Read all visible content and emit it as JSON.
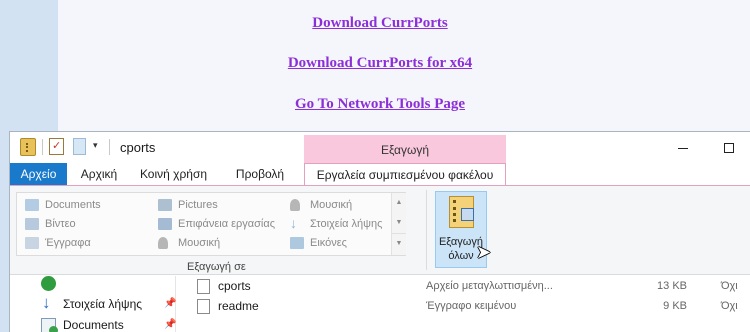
{
  "web": {
    "links": [
      "Download CurrPorts",
      "Download CurrPorts for x64",
      "Go To Network Tools Page"
    ]
  },
  "window": {
    "title": "cports",
    "contextual_tab_header": "Εξαγωγή",
    "controls": {
      "minimize": "minimize",
      "maximize": "maximize"
    }
  },
  "tabs": [
    "Αρχείο",
    "Αρχική",
    "Κοινή χρήση",
    "Προβολή",
    "Εργαλεία συμπιεσμένου φακέλου"
  ],
  "ribbon": {
    "extract_to_items": [
      {
        "label": "Documents",
        "icon": "documents-icon"
      },
      {
        "label": "Pictures",
        "icon": "pictures-icon"
      },
      {
        "label": "Μουσική",
        "icon": "music-icon"
      },
      {
        "label": "Βίντεο",
        "icon": "video-icon"
      },
      {
        "label": "Επιφάνεια εργασίας",
        "icon": "desktop-icon"
      },
      {
        "label": "Στοιχεία λήψης",
        "icon": "downloads-icon"
      },
      {
        "label": "Έγγραφα",
        "icon": "documents-icon"
      },
      {
        "label": "Μουσική",
        "icon": "music-icon"
      },
      {
        "label": "Εικόνες",
        "icon": "pictures-icon"
      }
    ],
    "group_label": "Εξαγωγή σε",
    "extract_all_label_line1": "Εξαγωγή",
    "extract_all_label_line2": "όλων"
  },
  "nav_pane": {
    "items": [
      {
        "label": "Στοιχεία λήψης",
        "pinned": true
      },
      {
        "label": "Documents",
        "pinned": true
      }
    ]
  },
  "files": [
    {
      "name": "cports",
      "type": "Αρχείο μεταγλωττισμένη...",
      "size": "13 KB",
      "extra": "Όχι"
    },
    {
      "name": "readme",
      "type": "Έγγραφο κειμένου",
      "size": "9 KB",
      "extra": "Όχι"
    }
  ]
}
